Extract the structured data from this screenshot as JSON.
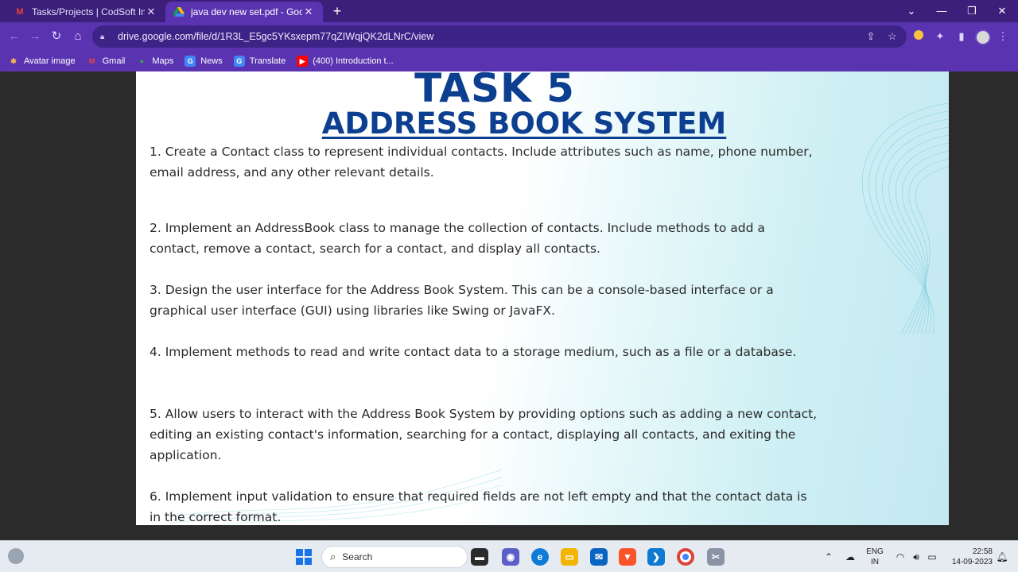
{
  "tabs": [
    {
      "title": "Tasks/Projects | CodSoft Internsh",
      "icon": "gmail-icon",
      "active": false
    },
    {
      "title": "java dev new set.pdf - Google Dr",
      "icon": "google-drive-icon",
      "active": true
    }
  ],
  "address_bar": {
    "url": "drive.google.com/file/d/1R3L_E5gc5YKsxepm77qZIWqjQK2dLNrC/view"
  },
  "bookmarks": [
    {
      "label": "Avatar image",
      "icon": "avatar-icon"
    },
    {
      "label": "Gmail",
      "icon": "gmail-icon"
    },
    {
      "label": "Maps",
      "icon": "maps-icon"
    },
    {
      "label": "News",
      "icon": "news-icon"
    },
    {
      "label": "Translate",
      "icon": "translate-icon"
    },
    {
      "label": "(400) Introduction t...",
      "icon": "youtube-icon"
    }
  ],
  "document": {
    "title": "TASK 5",
    "subtitle": "ADDRESS BOOK SYSTEM",
    "items": [
      "1. Create a Contact class to represent individual contacts. Include attributes such as name, phone number, email address, and any other relevant details.",
      "2. Implement an AddressBook class to manage the collection of contacts. Include methods to add a contact, remove a contact, search for a contact, and display all contacts.",
      "3. Design the user interface for the Address Book System. This can be a console-based interface or a graphical user interface (GUI) using libraries like Swing or JavaFX.",
      "4. Implement methods to read and write contact data to a storage medium, such as a file or a database.",
      "5. Allow users to interact with the Address Book System by providing options such as adding a new contact, editing an existing contact's information, searching for a contact, displaying all contacts, and exiting the application.",
      "6. Implement input validation to ensure that required fields are not left empty and that the contact data is in the correct format."
    ]
  },
  "taskbar": {
    "search_label": "Search",
    "language": "ENG",
    "region": "IN",
    "time": "22:58",
    "date": "14-09-2023"
  },
  "colors": {
    "tab_bar": "#3b1f7a",
    "toolbar": "#5a34b0",
    "title_blue": "#0c3f8f",
    "viewer_bg": "#2b2b2b"
  }
}
